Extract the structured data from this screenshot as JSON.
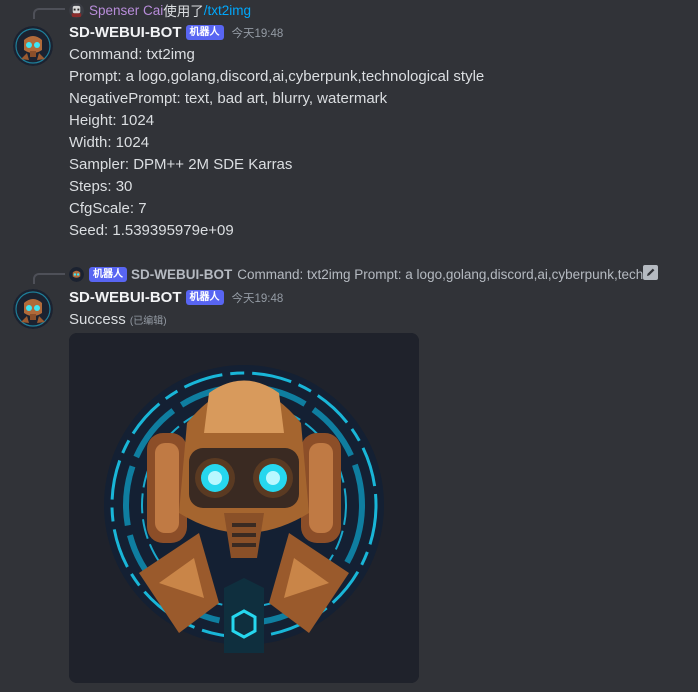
{
  "reply1": {
    "user": "Spenser Cai",
    "action": "使用了",
    "command": "/txt2img"
  },
  "message1": {
    "username": "SD-WEBUI-BOT",
    "bot_tag": "机器人",
    "time": "今天19:48",
    "lines": [
      "Command: txt2img",
      "Prompt: a logo,golang,discord,ai,cyberpunk,technological style",
      "NegativePrompt: text, bad art, blurry, watermark",
      "Height: 1024",
      "Width: 1024",
      "Sampler: DPM++ 2M SDE Karras",
      "Steps: 30",
      "CfgScale: 7",
      "Seed: 1.539395979e+09"
    ]
  },
  "reply2": {
    "bot_tag": "机器人",
    "username": "SD-WEBUI-BOT",
    "preview": "Command: txt2img Prompt: a logo,golang,discord,ai,cyberpunk,techı",
    "icon": "pencil-icon"
  },
  "message2": {
    "username": "SD-WEBUI-BOT",
    "bot_tag": "机器人",
    "time": "今天19:48",
    "text": "Success",
    "edited": "(已编辑)",
    "image": "robot-logo-image"
  },
  "colors": {
    "background": "#313338",
    "bot_tag": "#5865f2",
    "reply_user": "#b98ddb",
    "link": "#00a8fc"
  }
}
